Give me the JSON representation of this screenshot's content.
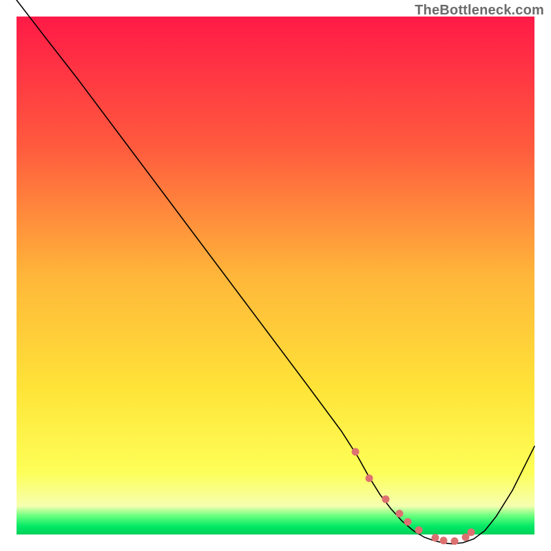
{
  "watermark": "TheBottleneck.com",
  "chart_data": {
    "type": "line",
    "title": "",
    "xlabel": "",
    "ylabel": "",
    "xlim": [
      0,
      100
    ],
    "ylim": [
      0,
      100
    ],
    "grid": false,
    "legend": "none",
    "gradient_stops": [
      {
        "offset": 0.0,
        "color": "#ff1a47"
      },
      {
        "offset": 0.25,
        "color": "#ff5a3e"
      },
      {
        "offset": 0.5,
        "color": "#ffb63a"
      },
      {
        "offset": 0.72,
        "color": "#ffe438"
      },
      {
        "offset": 0.88,
        "color": "#fdff58"
      },
      {
        "offset": 0.945,
        "color": "#f6ffb0"
      },
      {
        "offset": 0.965,
        "color": "#62ff7c"
      },
      {
        "offset": 0.985,
        "color": "#00e865"
      },
      {
        "offset": 1.0,
        "color": "#00d05a"
      }
    ],
    "gradient_region": {
      "x0": 3,
      "y0": 3,
      "x1": 97,
      "y1": 97
    },
    "series": [
      {
        "name": "bottleneck-curve",
        "color": "#000000",
        "width": 1.6,
        "x": [
          3,
          8,
          14,
          20,
          26,
          32,
          38,
          44,
          50,
          56,
          62,
          65,
          67,
          69,
          71,
          73,
          75,
          77,
          79,
          81,
          82,
          84,
          86,
          88,
          90,
          93,
          97
        ],
        "y": [
          100,
          93.5,
          85.8,
          77.8,
          69.8,
          61.8,
          53.8,
          45.8,
          37.8,
          29.8,
          21.7,
          17.0,
          13.4,
          10.2,
          7.6,
          5.4,
          3.7,
          2.5,
          1.8,
          1.4,
          1.3,
          1.5,
          2.2,
          3.7,
          6.2,
          11.0,
          19.0
        ]
      }
    ],
    "markers": {
      "name": "bottom-markers",
      "color": "#dd7171",
      "radius": 5.5,
      "x": [
        64.5,
        67.0,
        70.0,
        72.5,
        74.0,
        76.0,
        79.0,
        80.5,
        82.5,
        84.5,
        85.5
      ],
      "y": [
        18.0,
        13.2,
        9.4,
        6.8,
        5.3,
        3.8,
        2.4,
        1.9,
        1.8,
        2.5,
        3.4
      ]
    }
  }
}
